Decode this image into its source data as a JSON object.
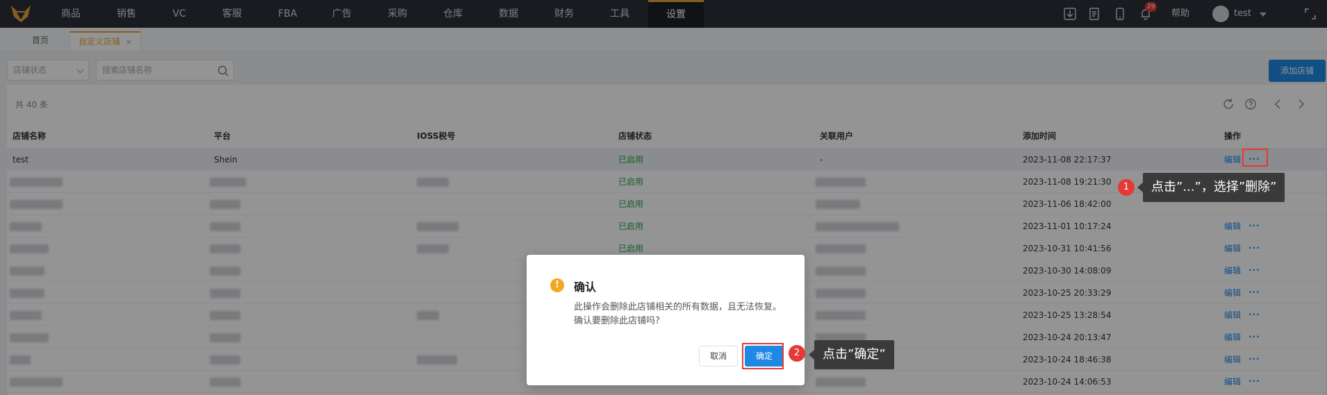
{
  "topnav": {
    "items": [
      "商品",
      "销售",
      "VC",
      "客服",
      "FBA",
      "广告",
      "采购",
      "仓库",
      "数据",
      "财务",
      "工具",
      "设置"
    ],
    "active": "设置",
    "notification_count": "29",
    "help_label": "帮助",
    "username": "test"
  },
  "tabs": {
    "home_label": "首页",
    "current_label": "自定义店铺",
    "close_glyph": "×"
  },
  "filters": {
    "status_placeholder": "店铺状态",
    "search_placeholder": "搜索店铺名称"
  },
  "add_button_label": "添加店铺",
  "table": {
    "total_text": "共 40 条",
    "columns": [
      "店铺名称",
      "平台",
      "IOSS税号",
      "店铺状态",
      "关联用户",
      "添加时间",
      "操作"
    ],
    "rows": [
      {
        "name": "test",
        "platform": "Shein",
        "status": "已启用",
        "user": "-",
        "time": "2023-11-08 22:17:37"
      },
      {
        "status": "已启用",
        "time": "2023-11-08 19:21:30"
      },
      {
        "status": "已启用",
        "time": "2023-11-06 18:42:00"
      },
      {
        "status": "已启用",
        "time": "2023-11-01 10:17:24"
      },
      {
        "status": "已启用",
        "time": "2023-10-31 10:41:56"
      },
      {
        "time": "2023-10-30 14:08:09"
      },
      {
        "time": "2023-10-25 20:33:29"
      },
      {
        "time": "2023-10-25 13:28:54"
      },
      {
        "time": "2023-10-24 20:13:47"
      },
      {
        "time": "2023-10-24 18:46:38"
      },
      {
        "time": "2023-10-24 14:06:53"
      }
    ],
    "edit_label": "编辑",
    "more_glyph": "···"
  },
  "dialog": {
    "title": "确认",
    "message": "此操作会删除此店铺相关的所有数据，且无法恢复。确认要删除此店铺吗?",
    "cancel_label": "取消",
    "ok_label": "确定",
    "warn_glyph": "!"
  },
  "callouts": [
    {
      "number": "1",
      "text": "点击”...”，选择”删除”"
    },
    {
      "number": "2",
      "text": "点击”确定”"
    }
  ],
  "colors": {
    "nav_bg": "#2b2f38",
    "accent_orange": "#e8a33a",
    "primary_blue": "#1e88e5",
    "status_green": "#27a844",
    "highlight_red": "#e53935"
  }
}
